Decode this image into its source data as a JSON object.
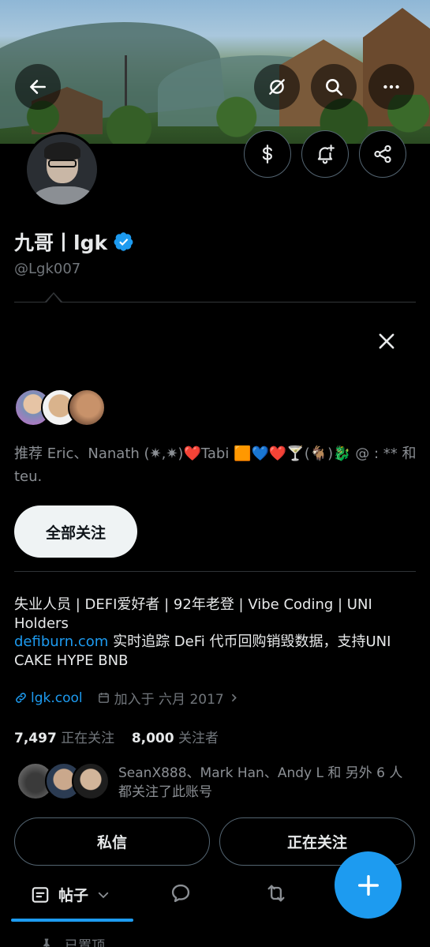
{
  "profile": {
    "display_name": "九哥丨lgk",
    "handle": "@Lgk007",
    "verified_color": "#1d9bf0"
  },
  "recommendation": {
    "text": "推荐 Eric、Nanath (✷,✷)❤️Tabi 🟧💙❤️🍸(🐐)🐉 @ : ** 和 teu.",
    "follow_all_label": "全部关注"
  },
  "bio": {
    "line1": "失业人员 | DEFI爱好者 | 92年老登 | Vibe Coding | UNI Holders",
    "link": "defiburn.com",
    "line2": " 实时追踪 DeFi 代币回购销毁数据，支持UNI CAKE HYPE BNB"
  },
  "meta": {
    "url": "lgk.cool",
    "joined": "加入于 六月 2017"
  },
  "counts": {
    "following_num": "7,497",
    "following_label": "正在关注",
    "followers_num": "8,000",
    "followers_label": "关注者"
  },
  "followed_by": {
    "text": "SeanX888、Mark Han、Andy L 和 另外 6 人 都关注了此账号"
  },
  "buttons": {
    "dm_label": "私信",
    "following_label": "正在关注"
  },
  "tabs": {
    "posts_label": "帖子"
  },
  "pinned": {
    "label": "已置顶"
  },
  "icons": {
    "back": "arrow-left-icon",
    "no_subscribe": "subscribe-off-icon",
    "search": "search-icon",
    "more": "more-icon",
    "tip": "dollar-icon",
    "notify": "bell-plus-icon",
    "share": "share-icon",
    "close": "close-icon",
    "compose": "plus-icon"
  }
}
